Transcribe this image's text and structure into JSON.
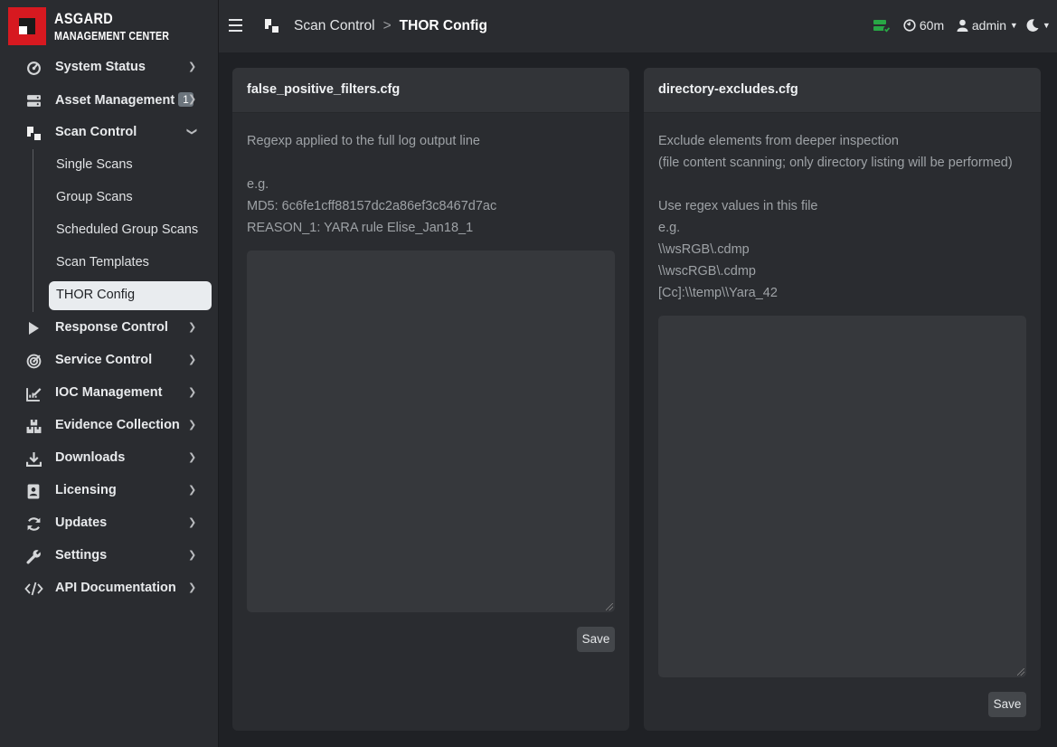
{
  "brand": {
    "line1": "ASGARD",
    "line2": "MANAGEMENT CENTER",
    "accent": "#d71920"
  },
  "sidebar": {
    "items": [
      {
        "label": "System Status",
        "icon": "gauge-icon"
      },
      {
        "label": "Asset Management",
        "icon": "server-icon",
        "badge": "1"
      },
      {
        "label": "Scan Control",
        "icon": "scan-icon",
        "expanded": true,
        "children": [
          {
            "label": "Single Scans"
          },
          {
            "label": "Group Scans"
          },
          {
            "label": "Scheduled Group Scans"
          },
          {
            "label": "Scan Templates"
          },
          {
            "label": "THOR Config",
            "active": true
          }
        ]
      },
      {
        "label": "Response Control",
        "icon": "play-icon"
      },
      {
        "label": "Service Control",
        "icon": "target-icon"
      },
      {
        "label": "IOC Management",
        "icon": "edit-chart-icon"
      },
      {
        "label": "Evidence Collection",
        "icon": "boxes-icon"
      },
      {
        "label": "Downloads",
        "icon": "download-icon"
      },
      {
        "label": "Licensing",
        "icon": "id-card-icon"
      },
      {
        "label": "Updates",
        "icon": "sync-icon"
      },
      {
        "label": "Settings",
        "icon": "wrench-icon"
      },
      {
        "label": "API Documentation",
        "icon": "code-icon"
      }
    ]
  },
  "topbar": {
    "breadcrumb": {
      "parent": "Scan Control",
      "separator": ">",
      "current": "THOR Config"
    },
    "session_timer": "60m",
    "user": "admin",
    "status_color": "#28a745"
  },
  "cards": {
    "left": {
      "title": "false_positive_filters.cfg",
      "description": [
        "Regexp applied to the full log output line",
        "",
        "e.g.",
        "MD5: 6c6fe1cff88157dc2a86ef3c8467d7ac",
        "REASON_1: YARA rule Elise_Jan18_1"
      ],
      "textarea_value": "",
      "save_label": "Save"
    },
    "right": {
      "title": "directory-excludes.cfg",
      "description": [
        "Exclude elements from deeper inspection",
        "(file content scanning; only directory listing will be performed)",
        "",
        "Use regex values in this file",
        "e.g.",
        "\\\\wsRGB\\.cdmp",
        "\\\\wscRGB\\.cdmp",
        "[Cc]:\\\\temp\\\\Yara_42"
      ],
      "textarea_value": "",
      "save_label": "Save"
    }
  }
}
